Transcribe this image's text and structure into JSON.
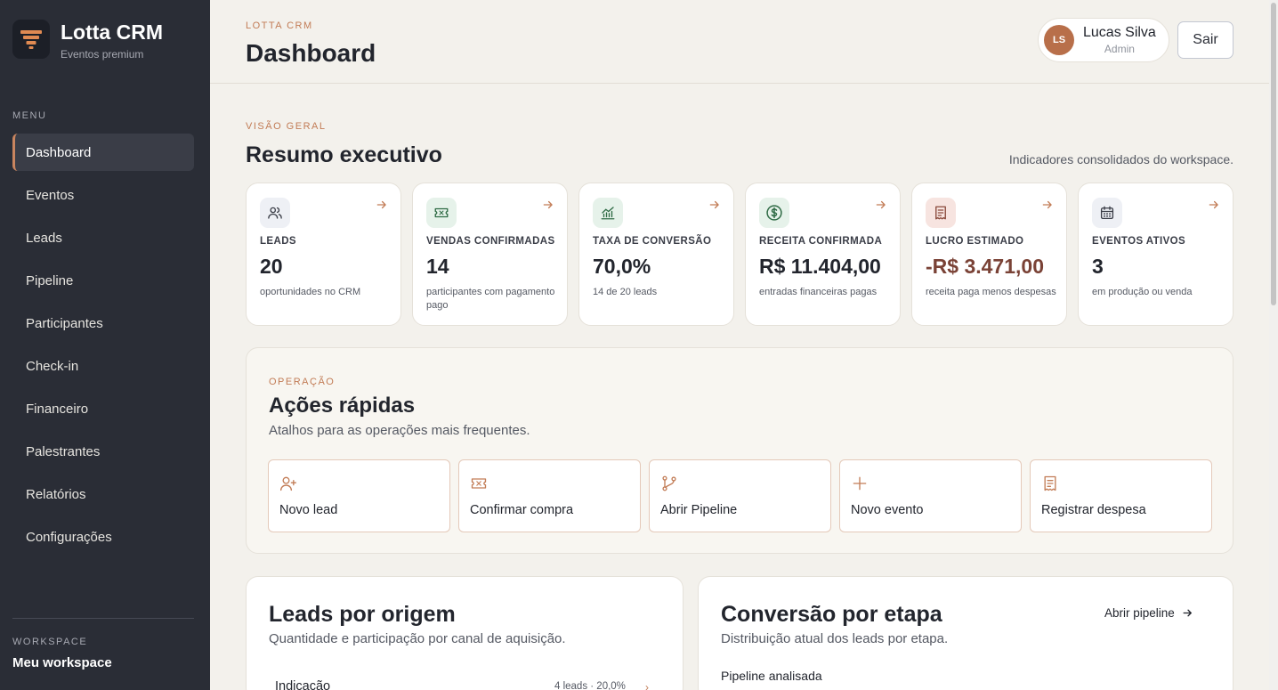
{
  "app": {
    "name": "Lotta CRM",
    "tagline": "Eventos premium"
  },
  "sidebar": {
    "menu_label": "MENU",
    "items": [
      {
        "label": "Dashboard",
        "active": true
      },
      {
        "label": "Eventos"
      },
      {
        "label": "Leads"
      },
      {
        "label": "Pipeline"
      },
      {
        "label": "Participantes"
      },
      {
        "label": "Check-in"
      },
      {
        "label": "Financeiro"
      },
      {
        "label": "Palestrantes"
      },
      {
        "label": "Relatórios"
      },
      {
        "label": "Configurações"
      }
    ],
    "workspace_label": "WORKSPACE",
    "workspace_name": "Meu workspace"
  },
  "header": {
    "eyebrow": "LOTTA CRM",
    "title": "Dashboard",
    "user": {
      "initials": "LS",
      "name": "Lucas Silva",
      "role": "Admin"
    },
    "logout_label": "Sair"
  },
  "overview": {
    "eyebrow": "VISÃO GERAL",
    "title": "Resumo executivo",
    "note": "Indicadores consolidados do workspace.",
    "kpis": [
      {
        "label": "LEADS",
        "value": "20",
        "desc": "oportunidades no CRM",
        "icon": "users-icon",
        "icon_bg": "#eef0f5",
        "icon_color": "#3a3d47"
      },
      {
        "label": "VENDAS CONFIRMADAS",
        "value": "14",
        "desc": "participantes com pagamento pago",
        "icon": "ticket-icon",
        "icon_bg": "#e6f2ea",
        "icon_color": "#2f6b45"
      },
      {
        "label": "TAXA DE CONVERSÃO",
        "value": "70,0%",
        "desc": "14 de 20 leads",
        "icon": "chart-up-icon",
        "icon_bg": "#e6f2ea",
        "icon_color": "#2f6b45"
      },
      {
        "label": "RECEITA CONFIRMADA",
        "value": "R$ 11.404,00",
        "desc": "entradas financeiras pagas",
        "icon": "dollar-icon",
        "icon_bg": "#e6f2ea",
        "icon_color": "#2f6b45"
      },
      {
        "label": "LUCRO ESTIMADO",
        "value": "-R$ 3.471,00",
        "desc": "receita paga menos despesas",
        "icon": "receipt-icon",
        "icon_bg": "#f7e4e0",
        "icon_color": "#8a4a3c",
        "negative": true
      },
      {
        "label": "EVENTOS ATIVOS",
        "value": "3",
        "desc": "em produção ou venda",
        "icon": "calendar-icon",
        "icon_bg": "#eef0f5",
        "icon_color": "#3a3d47"
      }
    ]
  },
  "quick_actions": {
    "eyebrow": "OPERAÇÃO",
    "title": "Ações rápidas",
    "subtitle": "Atalhos para as operações mais frequentes.",
    "items": [
      {
        "label": "Novo lead",
        "icon": "user-plus-icon"
      },
      {
        "label": "Confirmar compra",
        "icon": "ticket-icon"
      },
      {
        "label": "Abrir Pipeline",
        "icon": "git-branch-icon"
      },
      {
        "label": "Novo evento",
        "icon": "plus-icon"
      },
      {
        "label": "Registrar despesa",
        "icon": "receipt-icon"
      }
    ]
  },
  "leads_origin": {
    "title": "Leads por origem",
    "subtitle": "Quantidade e participação por canal de aquisição.",
    "rows": [
      {
        "label": "Indicação",
        "meta": "4 leads · 20,0%"
      }
    ]
  },
  "stage_conversion": {
    "title": "Conversão por etapa",
    "subtitle": "Distribuição atual dos leads por etapa.",
    "link_label": "Abrir pipeline",
    "pipeline_label": "Pipeline analisada"
  },
  "colors": {
    "accent": "#c27c56",
    "sidebar": "#2a2d36",
    "background": "#f3f1ec",
    "negative": "#7a4236"
  }
}
